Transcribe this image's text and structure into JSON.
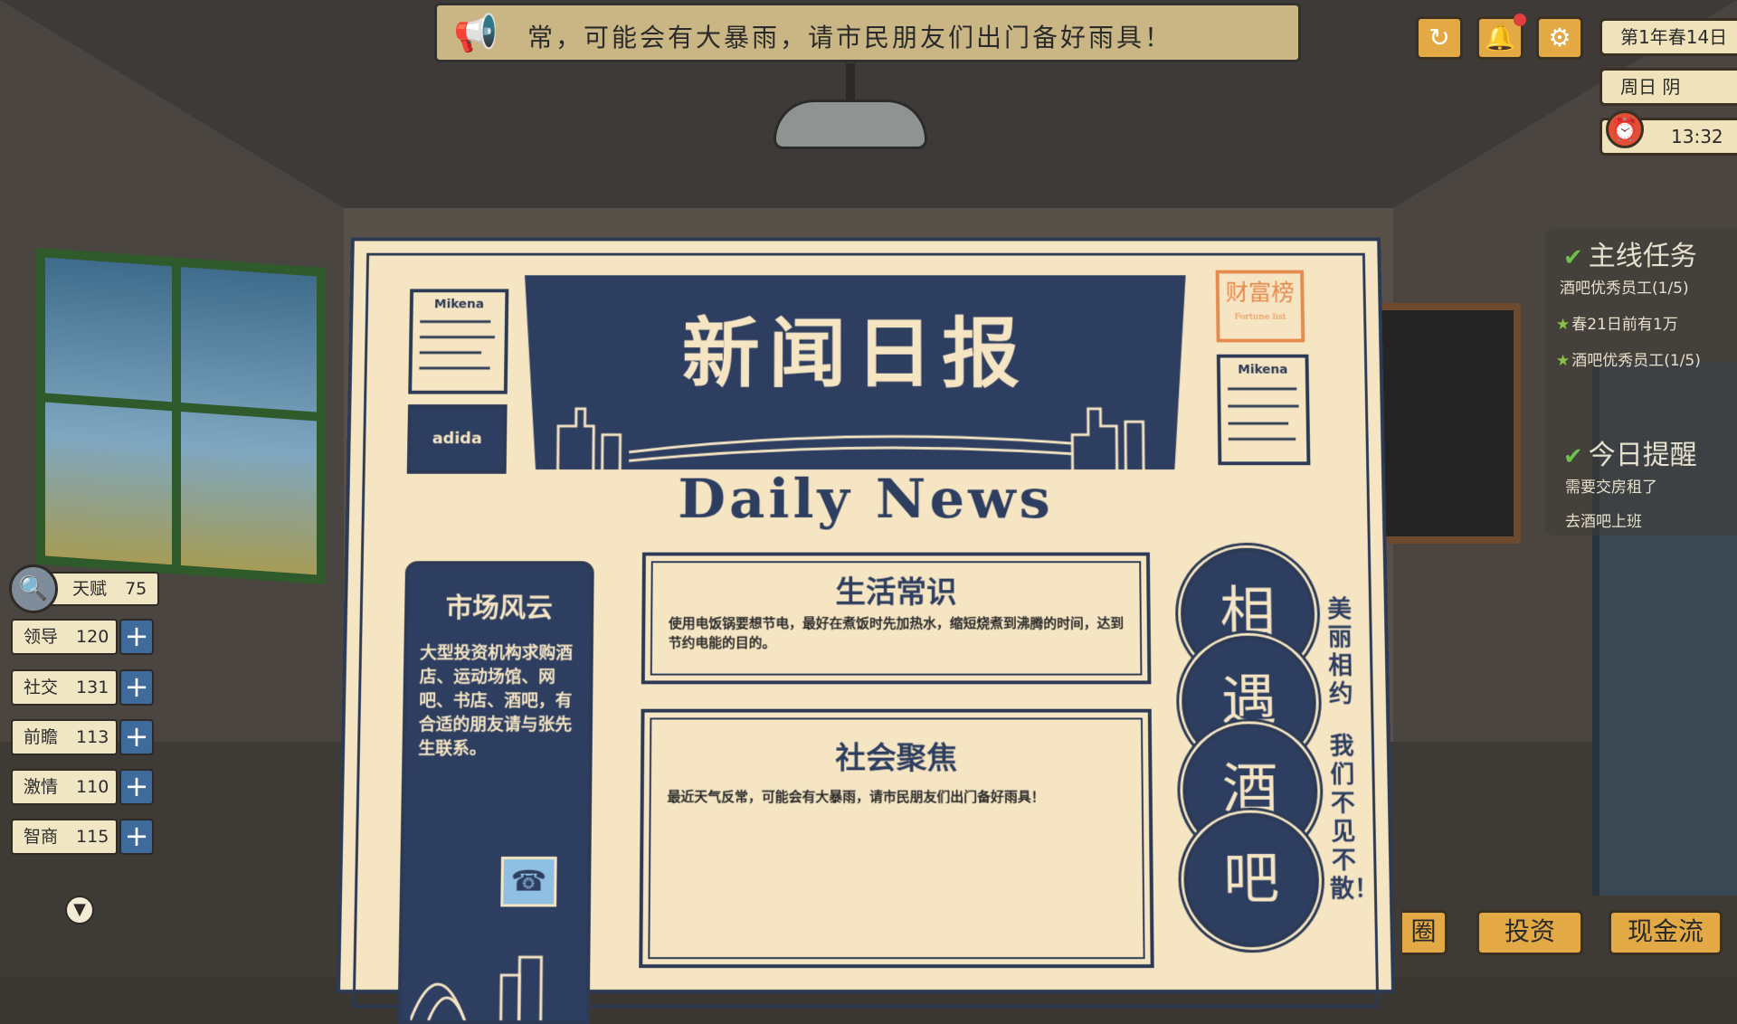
{
  "announcement": {
    "text": "常，可能会有大暴雨，请市民朋友们出门备好雨具！"
  },
  "top_right": {
    "date": "第1年春14日",
    "weekday_weather": "周日    阴",
    "time": "13:32"
  },
  "quests": {
    "main_title": "主线任务",
    "main_items": [
      "酒吧优秀员工(1/5)",
      "春21日前有1万",
      "酒吧优秀员工(1/5)"
    ],
    "reminder_title": "今日提醒",
    "reminder_items": [
      "需要交房租了",
      "去酒吧上班"
    ]
  },
  "stats": {
    "talent": {
      "label": "天赋",
      "value": "75"
    },
    "items": [
      {
        "label": "领导",
        "value": "120"
      },
      {
        "label": "社交",
        "value": "131"
      },
      {
        "label": "前瞻",
        "value": "113"
      },
      {
        "label": "激情",
        "value": "110"
      },
      {
        "label": "智商",
        "value": "115"
      }
    ]
  },
  "bottom_buttons": {
    "partial": "圈",
    "invest": "投资",
    "cashflow": "现金流"
  },
  "newspaper": {
    "title_cn": "新闻日报",
    "title_en": "Daily News",
    "ad_top_left": "Mikena",
    "ad_brand": "adida",
    "ad_top_right": "Mikena",
    "stamp": "财富榜",
    "stamp_sub": "Fortune list",
    "market_title": "市场风云",
    "market_text": "大型投资机构求购酒店、运动场馆、网吧、书店、酒吧，有合适的朋友请与张先生联系。",
    "article1_title": "生活常识",
    "article1_text": "使用电饭锅要想节电，最好在煮饭时先加热水，缩短烧煮到沸腾的时间，达到节约电能的目的。",
    "article2_title": "社会聚焦",
    "article2_text": "最近天气反常，可能会有大暴雨，请市民朋友们出门备好雨具！",
    "pub_chars": [
      "相",
      "遇",
      "酒",
      "吧"
    ],
    "slogan1": "美丽相约",
    "slogan2": "我们不见不散！"
  },
  "colors": {
    "navy": "#2e3e60",
    "paper": "#f5e5c3",
    "button_gold": "#e2a945",
    "stat_plus": "#3e6b9b"
  }
}
